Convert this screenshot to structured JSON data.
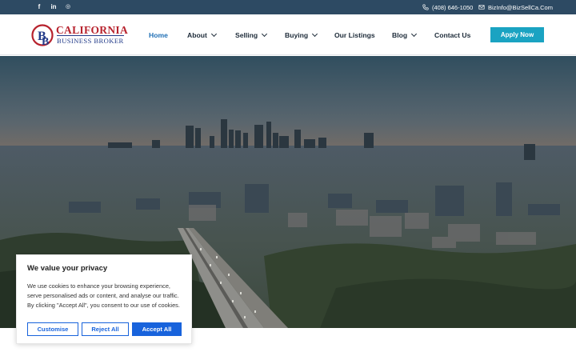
{
  "topbar": {
    "social": [
      {
        "icon": "facebook-icon",
        "glyph": "f"
      },
      {
        "icon": "linkedin-icon",
        "glyph": "in"
      },
      {
        "icon": "instagram-icon",
        "glyph": "◎"
      }
    ],
    "phone": "(408) 646-1050",
    "email": "BizInfo@BizSellCa.Com"
  },
  "header": {
    "logo": {
      "line1": "CALIFORNIA",
      "line2": "BUSINESS BROKER"
    },
    "nav": [
      {
        "label": "Home",
        "active": true,
        "dropdown": false
      },
      {
        "label": "About",
        "active": false,
        "dropdown": true
      },
      {
        "label": "Selling",
        "active": false,
        "dropdown": true
      },
      {
        "label": "Buying",
        "active": false,
        "dropdown": true
      },
      {
        "label": "Our Listings",
        "active": false,
        "dropdown": false
      },
      {
        "label": "Blog",
        "active": false,
        "dropdown": true
      },
      {
        "label": "Contact Us",
        "active": false,
        "dropdown": false
      }
    ],
    "apply_label": "Apply Now"
  },
  "cookie": {
    "title": "We value your privacy",
    "body": "We use cookies to enhance your browsing experience, serve personalised ads or content, and analyse our traffic. By clicking \"Accept All\", you consent to our use of cookies.",
    "customise_label": "Customise",
    "reject_label": "Reject All",
    "accept_label": "Accept All"
  },
  "colors": {
    "topbar_bg": "#2d4a63",
    "nav_active": "#1f6fb5",
    "apply_bg": "#1aa3c2",
    "cookie_accent": "#1863dc",
    "logo_red": "#b7222d",
    "logo_blue": "#233c8a"
  }
}
